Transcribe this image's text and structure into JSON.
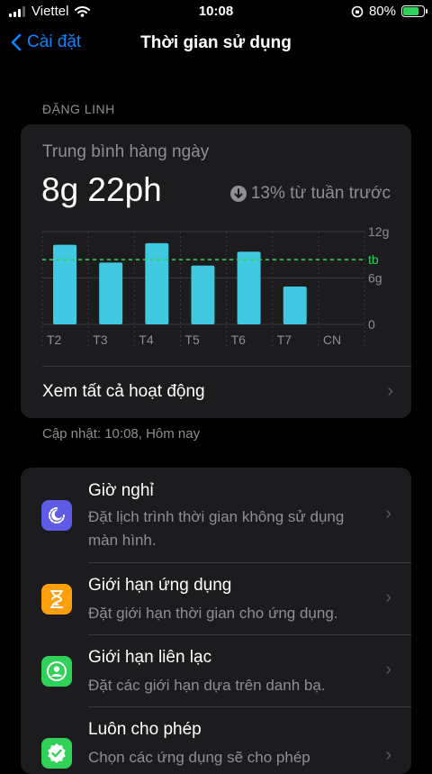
{
  "status": {
    "carrier": "Viettel",
    "time": "10:08",
    "battery": "80%",
    "battery_level": 0.8
  },
  "nav": {
    "back_label": "Cài đặt",
    "title": "Thời gian sử dụng"
  },
  "section_header": "ĐẶNG LINH",
  "usage": {
    "avg_label": "Trung bình hàng ngày",
    "avg_value": "8g 22ph",
    "trend": "13% từ tuần trước",
    "see_all": "Xem tất cả hoạt động"
  },
  "chart_data": {
    "type": "bar",
    "categories": [
      "T2",
      "T3",
      "T4",
      "T5",
      "T6",
      "T7",
      "CN"
    ],
    "values": [
      10.3,
      8.0,
      10.5,
      7.6,
      9.4,
      4.9,
      0
    ],
    "y_ticks": [
      {
        "value": 12,
        "label": "12g"
      },
      {
        "value": 6,
        "label": "6g"
      },
      {
        "value": 0,
        "label": "0"
      }
    ],
    "average": 8.37,
    "average_label": "tb",
    "ylim": [
      0,
      12
    ],
    "bar_color": "#40c8e0",
    "average_color": "#30d158"
  },
  "updated": "Cập nhật: 10:08, Hôm nay",
  "settings": [
    {
      "title": "Giờ nghỉ",
      "subtitle_lines": [
        "Đặt lịch trình thời gian không sử dụng",
        "màn hình."
      ],
      "icon": "downtime-icon",
      "color": "#5e5ce6"
    },
    {
      "title": "Giới hạn ứng dụng",
      "subtitle_lines": [
        "Đặt giới hạn thời gian cho ứng dụng."
      ],
      "icon": "hourglass-icon",
      "color": "#ff9f0a"
    },
    {
      "title": "Giới hạn liên lạc",
      "subtitle_lines": [
        "Đặt các giới hạn dựa trên danh bạ."
      ],
      "icon": "contact-icon",
      "color": "#30d158"
    },
    {
      "title": "Luôn cho phép",
      "subtitle_lines": [
        "Chọn các ứng dụng sẽ cho phép"
      ],
      "icon": "checkmark-badge-icon",
      "color": "#30d158"
    }
  ]
}
